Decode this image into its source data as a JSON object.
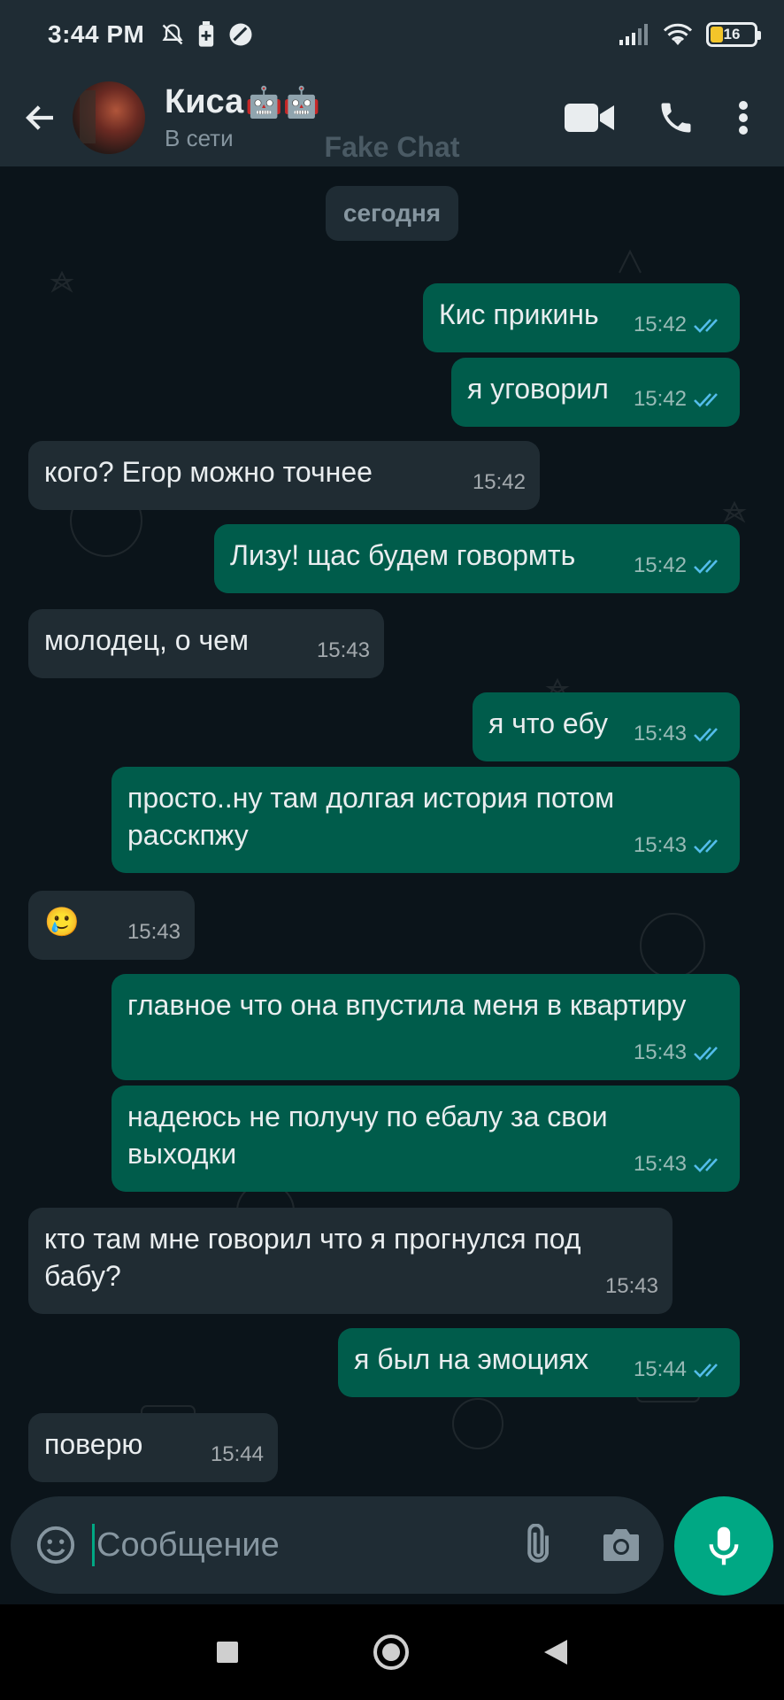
{
  "status_bar": {
    "time": "3:44 PM",
    "battery": "16"
  },
  "header": {
    "contact_name": "Киса",
    "contact_emoji": "🤖🤖",
    "contact_status": "В сети",
    "watermark": "Fake Chat"
  },
  "chat": {
    "date_chip": "сегодня",
    "messages": [
      {
        "dir": "out",
        "text": "Кис прикинь",
        "time": "15:42"
      },
      {
        "dir": "out",
        "text": "я уговорил",
        "time": "15:42"
      },
      {
        "dir": "in",
        "text": "кого? Егор можно точнее",
        "time": "15:42"
      },
      {
        "dir": "out",
        "text": "Лизу! щас будем говормть",
        "time": "15:42"
      },
      {
        "dir": "in",
        "text": "молодец, о чем",
        "time": "15:43"
      },
      {
        "dir": "out",
        "text": "я что ебу",
        "time": "15:43"
      },
      {
        "dir": "out",
        "text": "просто..ну там долгая история потом расскпжу",
        "time": "15:43"
      },
      {
        "dir": "in",
        "text": "🥲",
        "time": "15:43"
      },
      {
        "dir": "out",
        "text": "главное что она впустила меня в квартиру",
        "time": "15:43"
      },
      {
        "dir": "out",
        "text": "надеюсь не получу по ебалу за свои выходки",
        "time": "15:43"
      },
      {
        "dir": "in",
        "text": "кто там мне говорил что я прогнулся под бабу?",
        "time": "15:43"
      },
      {
        "dir": "out",
        "text": "я был на эмоциях",
        "time": "15:44"
      },
      {
        "dir": "in",
        "text": "поверю",
        "time": "15:44"
      }
    ]
  },
  "input": {
    "placeholder": "Сообщение"
  },
  "colors": {
    "outgoing_bubble": "#005c4b",
    "incoming_bubble": "#202c33",
    "accent": "#00a884",
    "read_ticks": "#53bdeb"
  }
}
